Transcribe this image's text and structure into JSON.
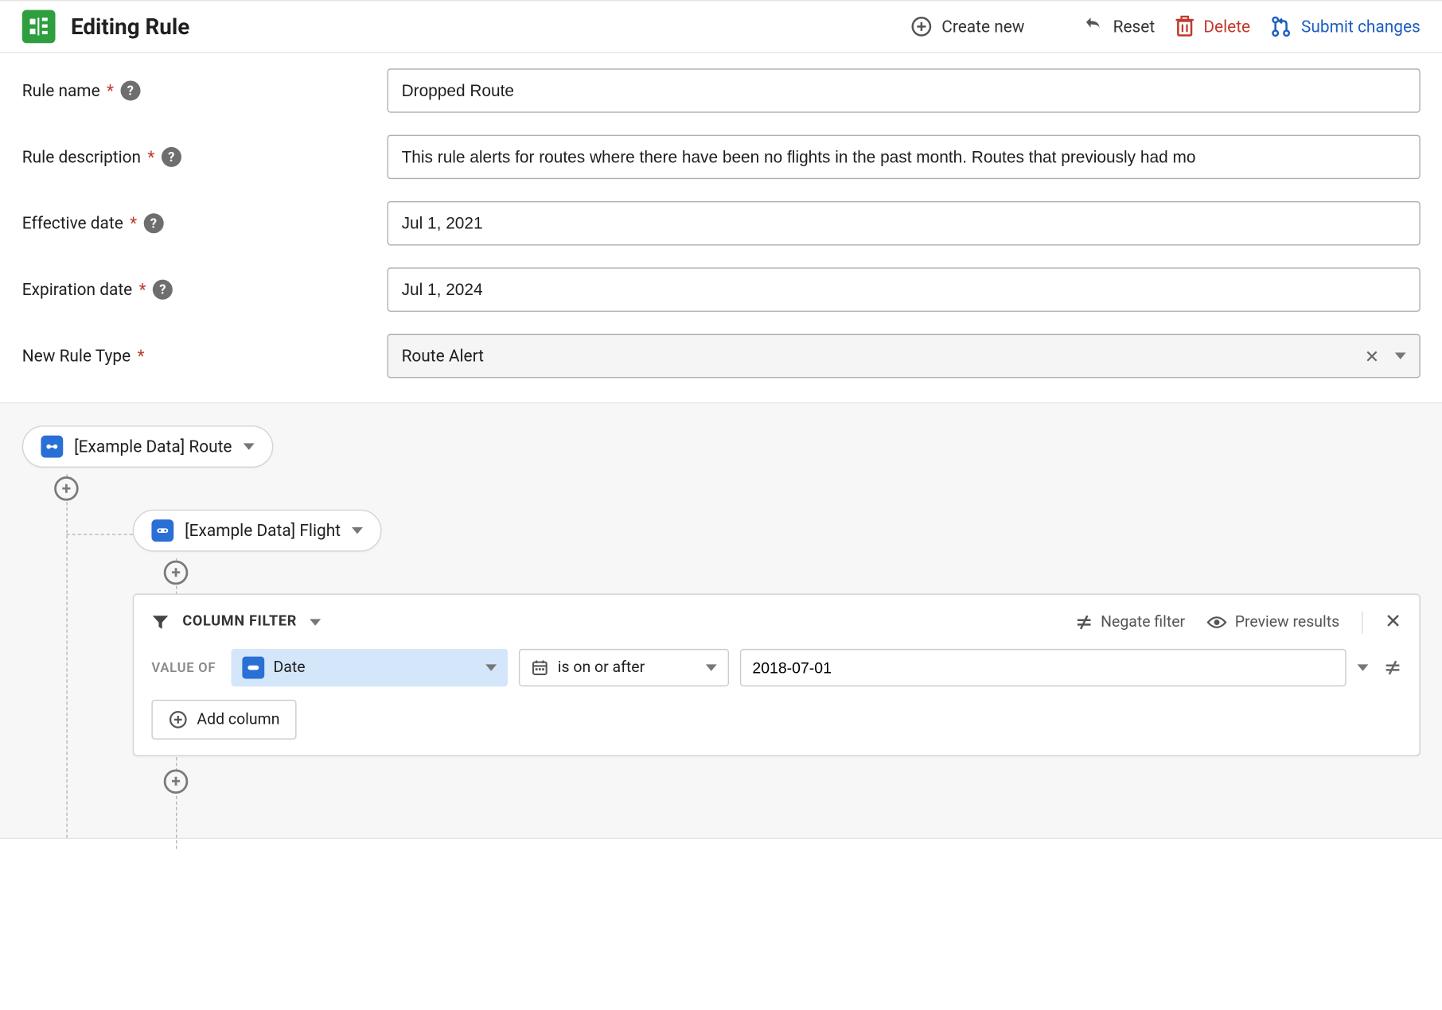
{
  "header": {
    "title": "Editing Rule",
    "create_new": "Create new",
    "reset": "Reset",
    "delete": "Delete",
    "submit": "Submit changes"
  },
  "form": {
    "rule_name": {
      "label": "Rule name",
      "value": "Dropped Route"
    },
    "rule_desc": {
      "label": "Rule description",
      "value": "This rule alerts for routes where there have been no flights in the past month. Routes that previously had mo"
    },
    "eff_date": {
      "label": "Effective date",
      "value": "Jul 1, 2021"
    },
    "exp_date": {
      "label": "Expiration date",
      "value": "Jul 1, 2024"
    },
    "rule_type": {
      "label": "New Rule Type",
      "value": "Route Alert"
    }
  },
  "builder": {
    "node1_label": "[Example Data] Route",
    "node2_label": "[Example Data] Flight",
    "filter": {
      "title": "COLUMN FILTER",
      "negate": "Negate filter",
      "preview": "Preview results",
      "value_of": "VALUE OF",
      "column": "Date",
      "operator": "is on or after",
      "date_value": "2018-07-01",
      "add_column": "Add column"
    }
  }
}
